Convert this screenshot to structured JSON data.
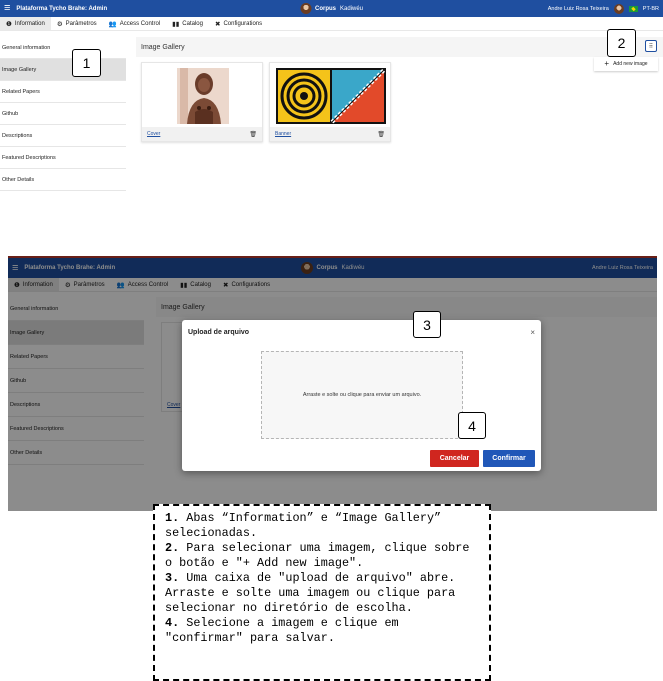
{
  "app": {
    "brand": "Plataforma Tycho Brahe: Admin",
    "corpus_label": "Corpus",
    "corpus_name": "Kadiwéu",
    "user_name": "Andre Luiz Rosa Teixeira",
    "language": "PT-BR",
    "user_name_cropped": "Andre Luiz Rosa Teixeira"
  },
  "tabs": [
    {
      "icon": "info-icon",
      "glyph": "❶",
      "label": "Information"
    },
    {
      "icon": "settings-icon",
      "glyph": "⚙",
      "label": "Parâmetros"
    },
    {
      "icon": "people-icon",
      "glyph": "👥",
      "label": "Access Control"
    },
    {
      "icon": "catalog-icon",
      "glyph": "▮▮",
      "label": "Catalog"
    },
    {
      "icon": "configurations-icon",
      "glyph": "✖",
      "label": "Configurations"
    }
  ],
  "sidebar": {
    "items": [
      "General information",
      "Image Gallery",
      "Related Papers",
      "Github",
      "Descriptions",
      "Featured Descriptions",
      "Other Details"
    ]
  },
  "gallery": {
    "title": "Image Gallery",
    "add_button": "Add new image",
    "images": [
      {
        "label": "Cover"
      },
      {
        "label": "Banner"
      }
    ]
  },
  "upload_modal": {
    "title": "Upload de arquivo",
    "dropzone_text": "Arraste e solte ou clique para enviar um arquivo.",
    "cancel": "Cancelar",
    "confirm": "Confirmar"
  },
  "bottom_gallery_label": "Cover",
  "callouts": [
    "1",
    "2",
    "3",
    "4"
  ],
  "instructions": {
    "n1": "1.",
    "t1": " Abas “Information” e “Image Gallery” selecionadas.",
    "n2": "2.",
    "t2": " Para selecionar uma imagem, clique sobre o botão e \"+ Add new image\".",
    "n3": "3.",
    "t3": " Uma caixa de \"upload de arquivo\" abre. Arraste e solte uma imagem ou clique para selecionar no diretório de escolha.",
    "n4": "4.",
    "t4": " Selecione a imagem e clique em \"confirmar\" para salvar."
  },
  "colors": {
    "topbar": "#1f4fa0",
    "cancel": "#d0261f",
    "confirm": "#2057b8"
  }
}
